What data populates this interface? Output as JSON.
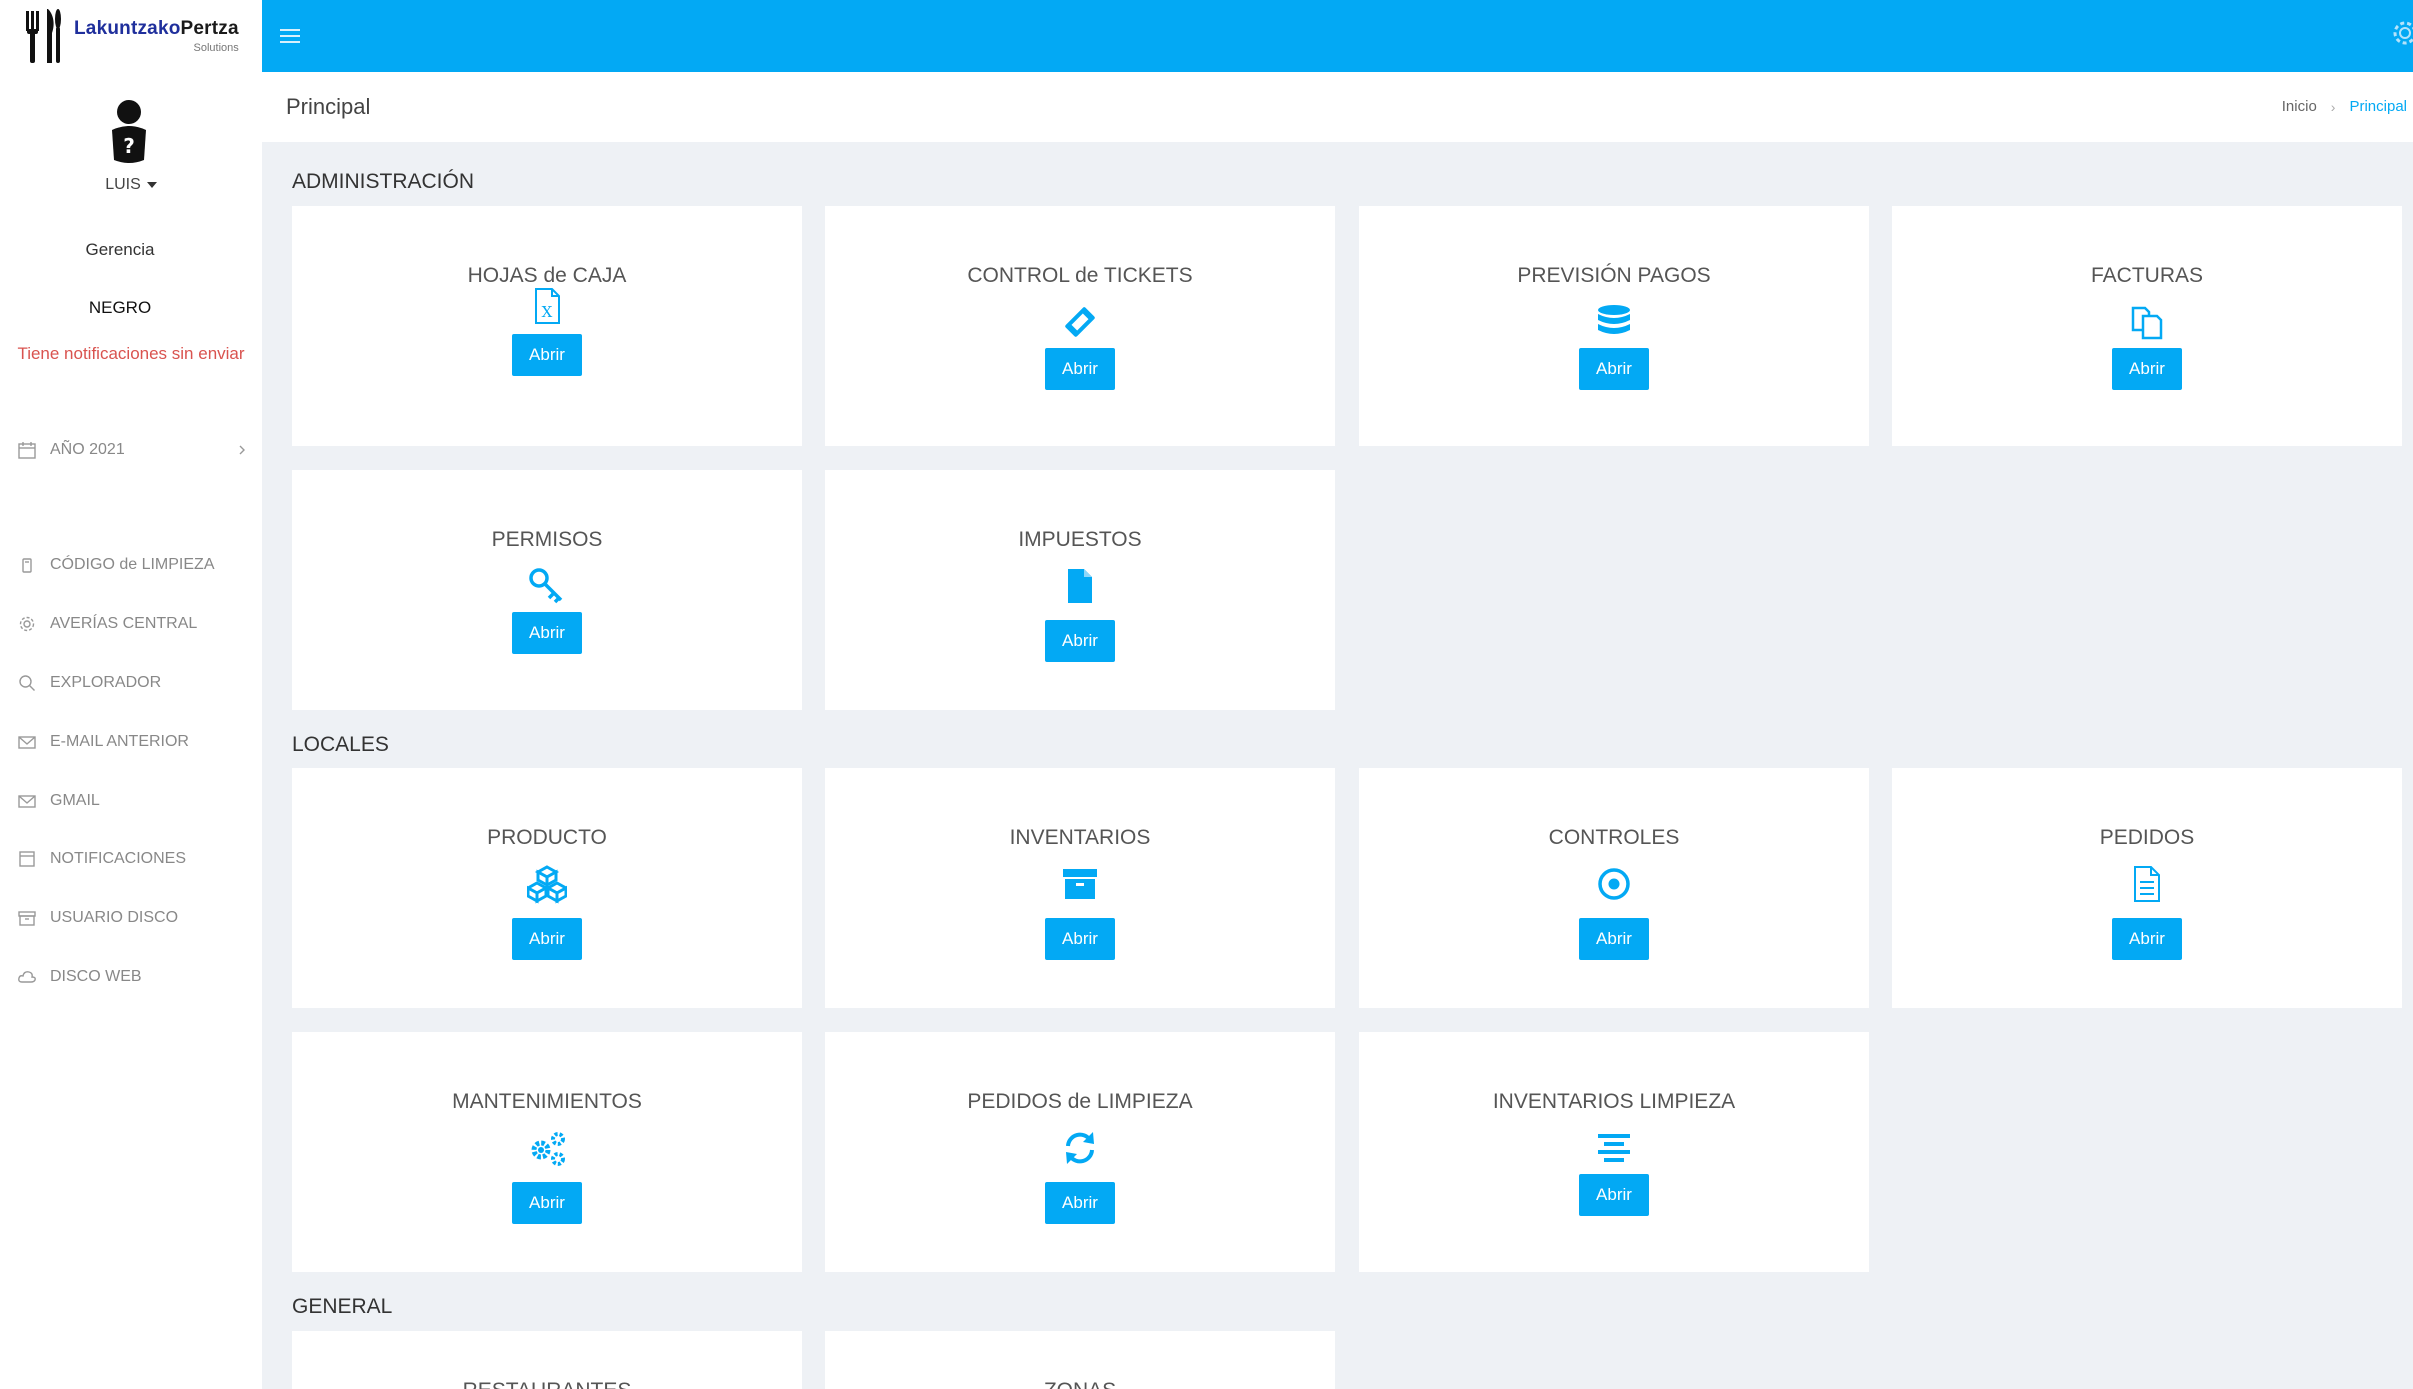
{
  "brand": {
    "name_part1": "Lakuntzako",
    "name_part2": "Pertza",
    "subtitle": "Solutions"
  },
  "user": {
    "name": "LUIS",
    "role": "Gerencia",
    "group": "NEGRO",
    "notification": "Tiene notificaciones sin enviar"
  },
  "sidebar": {
    "year": "AÑO 2021",
    "items": [
      {
        "label": "CÓDIGO de LIMPIEZA",
        "icon": "badge-icon"
      },
      {
        "label": "AVERÍAS CENTRAL",
        "icon": "gear-icon"
      },
      {
        "label": "EXPLORADOR",
        "icon": "search-icon"
      },
      {
        "label": "E-MAIL ANTERIOR",
        "icon": "mail-icon"
      },
      {
        "label": "GMAIL",
        "icon": "mail-icon"
      },
      {
        "label": "NOTIFICACIONES",
        "icon": "calendar-icon"
      },
      {
        "label": "USUARIO DISCO",
        "icon": "archive-icon"
      },
      {
        "label": "DISCO WEB",
        "icon": "cloud-icon"
      }
    ]
  },
  "header": {
    "title": "Principal",
    "breadcrumb_home": "Inicio",
    "breadcrumb_current": "Principal"
  },
  "button_label": "Abrir",
  "sections": [
    {
      "title": "ADMINISTRACIÓN",
      "cards": [
        {
          "title": "HOJAS de CAJA",
          "icon": "excel-file-icon"
        },
        {
          "title": "CONTROL de TICKETS",
          "icon": "ticket-icon"
        },
        {
          "title": "PREVISIÓN PAGOS",
          "icon": "database-icon"
        },
        {
          "title": "FACTURAS",
          "icon": "copy-icon"
        },
        {
          "title": "PERMISOS",
          "icon": "key-icon"
        },
        {
          "title": "IMPUESTOS",
          "icon": "file-icon"
        }
      ]
    },
    {
      "title": "LOCALES",
      "cards": [
        {
          "title": "PRODUCTO",
          "icon": "cubes-icon"
        },
        {
          "title": "INVENTARIOS",
          "icon": "archive-icon"
        },
        {
          "title": "CONTROLES",
          "icon": "target-icon"
        },
        {
          "title": "PEDIDOS",
          "icon": "document-icon"
        },
        {
          "title": "MANTENIMIENTOS",
          "icon": "cogs-icon"
        },
        {
          "title": "PEDIDOS de LIMPIEZA",
          "icon": "refresh-icon"
        },
        {
          "title": "INVENTARIOS LIMPIEZA",
          "icon": "align-center-icon"
        }
      ]
    },
    {
      "title": "GENERAL",
      "cards": [
        {
          "title": "RESTAURANTES",
          "icon": ""
        },
        {
          "title": "ZONAS",
          "icon": ""
        }
      ]
    }
  ],
  "colors": {
    "accent": "#03a9f4",
    "notification": "#d9534f",
    "background": "#eef1f5"
  }
}
